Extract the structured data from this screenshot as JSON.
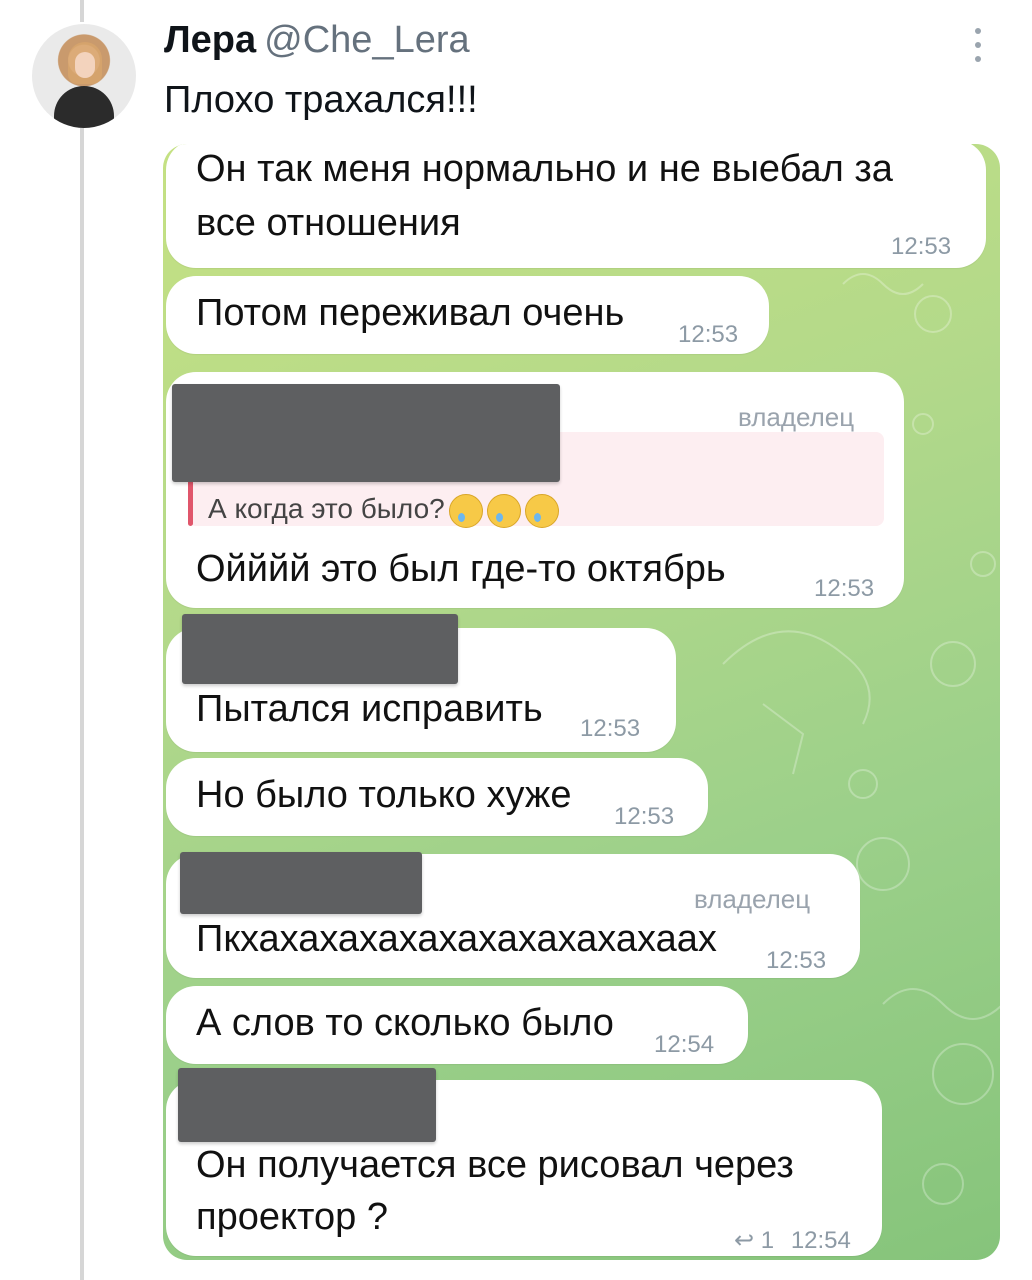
{
  "tweet": {
    "author_name": "Лера",
    "author_handle": "@Che_Lera",
    "text": "Плохо трахался!!!"
  },
  "messages": [
    {
      "lines": [
        "Он так меня нормально и не выебал за",
        "все отношения"
      ],
      "time": "12:53"
    },
    {
      "lines": [
        "Потом переживал очень"
      ],
      "time": "12:53"
    },
    {
      "role": "владелец",
      "quote": "А когда это было?",
      "lines": [
        "Ойййй это был где-то октябрь"
      ],
      "time": "12:53"
    },
    {
      "lines": [
        "Пытался исправить"
      ],
      "time": "12:53"
    },
    {
      "lines": [
        "Но было только хуже"
      ],
      "time": "12:53"
    },
    {
      "role": "владелец",
      "lines": [
        "Пкхахахахахахахахахахахаах"
      ],
      "time": "12:53"
    },
    {
      "lines": [
        "А слов то сколько было"
      ],
      "time": "12:54"
    },
    {
      "lines": [
        "Он получается все рисовал через",
        "проектор ?"
      ],
      "replies": "1",
      "time": "12:54"
    }
  ],
  "icons": {
    "more": "more-vertical-icon",
    "reply": "reply-arrow-icon",
    "emoji": "crying-face-emoji"
  },
  "colors": {
    "chat_bg_top": "#c5e183",
    "chat_bg_bottom": "#86c47b",
    "quote_bar": "#e0566b",
    "redaction": "#5e5f61"
  }
}
